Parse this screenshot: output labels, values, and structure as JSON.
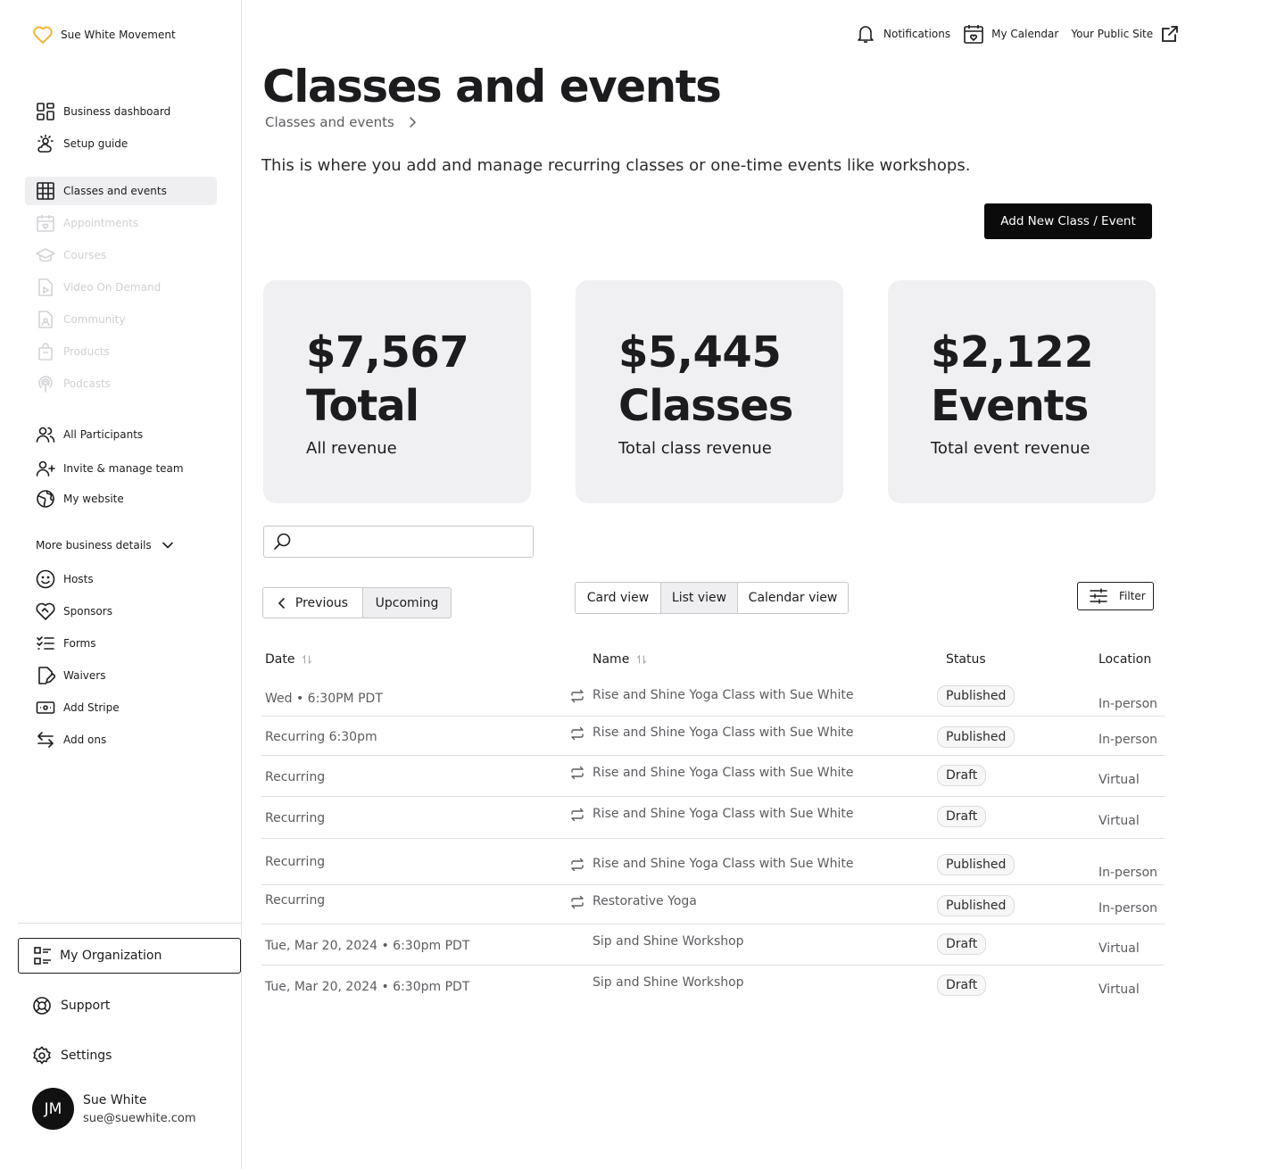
{
  "brand": {
    "name": "Sue White Movement",
    "icon": "heart-icon",
    "accent": "#f2b63c"
  },
  "topbar": {
    "notifications": "Notifications",
    "calendar": "My Calendar",
    "public_site": "Your Public Site"
  },
  "sidebar": {
    "main": [
      {
        "label": "Business dashboard",
        "icon": "dashboard-icon"
      },
      {
        "label": "Setup guide",
        "icon": "sun-cloud-icon"
      }
    ],
    "products": [
      {
        "label": "Classes and events",
        "icon": "table-icon",
        "active": true
      },
      {
        "label": "Appointments",
        "icon": "calendar-heart-icon",
        "disabled": true
      },
      {
        "label": "Courses",
        "icon": "graduation-cap-icon",
        "disabled": true
      },
      {
        "label": "Video On Demand",
        "icon": "video-file-icon",
        "disabled": true
      },
      {
        "label": "Community",
        "icon": "community-file-icon",
        "disabled": true
      },
      {
        "label": "Products",
        "icon": "bag-icon",
        "disabled": true
      },
      {
        "label": "Podcasts",
        "icon": "podcast-icon",
        "disabled": true
      }
    ],
    "people": [
      {
        "label": "All Participants",
        "icon": "users-icon"
      },
      {
        "label": "Invite & manage team",
        "icon": "user-plus-icon"
      },
      {
        "label": "My website",
        "icon": "globe-icon"
      }
    ],
    "more_label": "More business details",
    "details": [
      {
        "label": "Hosts",
        "icon": "smile-icon"
      },
      {
        "label": "Sponsors",
        "icon": "handshake-heart-icon"
      },
      {
        "label": "Forms",
        "icon": "checklist-icon"
      },
      {
        "label": "Waivers",
        "icon": "document-edit-icon"
      },
      {
        "label": "Add Stripe",
        "icon": "card-icon"
      },
      {
        "label": "Add ons",
        "icon": "arrows-swap-icon"
      }
    ],
    "organization": "My Organization",
    "support": "Support",
    "settings": "Settings",
    "user": {
      "initials": "JM",
      "name": "Sue White",
      "email": "sue@suewhite.com"
    }
  },
  "page": {
    "title": "Classes and events",
    "breadcrumb": "Classes and events",
    "intro": "This is where you add  and manage recurring classes or one-time events like workshops.",
    "add_button": "Add New Class / Event"
  },
  "stats": [
    {
      "amount": "$7,567",
      "label": "Total",
      "sub": "All revenue"
    },
    {
      "amount": "$5,445",
      "label": "Classes",
      "sub": "Total class revenue"
    },
    {
      "amount": "$2,122",
      "label": "Events",
      "sub": "Total event revenue"
    }
  ],
  "search": {
    "placeholder": ""
  },
  "time_toggle": {
    "previous": "Previous",
    "upcoming": "Upcoming",
    "selected": "Upcoming"
  },
  "view_toggle": {
    "card": "Card view",
    "list": "List view",
    "calendar": "Calendar view",
    "selected": "List view"
  },
  "filter_label": "Filter",
  "table": {
    "headers": {
      "date": "Date",
      "name": "Name",
      "status": "Status",
      "location": "Location"
    },
    "rows": [
      {
        "date": "Wed • 6:30PM PDT",
        "recurring": true,
        "name": "Rise and Shine Yoga Class with Sue White",
        "status": "Published",
        "location": "In-person"
      },
      {
        "date": "Recurring 6:30pm",
        "recurring": true,
        "name": "Rise and Shine Yoga Class with Sue White",
        "status": "Published",
        "location": "In-person"
      },
      {
        "date": "Recurring",
        "recurring": true,
        "name": "Rise and Shine Yoga Class with Sue White",
        "status": "Draft",
        "location": "Virtual"
      },
      {
        "date": "Recurring",
        "recurring": true,
        "name": "Rise and Shine Yoga Class with Sue White",
        "status": "Draft",
        "location": "Virtual"
      },
      {
        "date": "Recurring",
        "recurring": true,
        "name": "Rise and Shine Yoga Class with Sue White",
        "status": "Published",
        "location": "In-person"
      },
      {
        "date": "Recurring",
        "recurring": true,
        "name": "Restorative Yoga",
        "status": "Published",
        "location": "In-person"
      },
      {
        "date": "Tue, Mar 20, 2024 • 6:30pm PDT",
        "recurring": false,
        "name": "Sip and Shine Workshop",
        "status": "Draft",
        "location": "Virtual"
      },
      {
        "date": "Tue, Mar 20, 2024 • 6:30pm PDT",
        "recurring": false,
        "name": "Sip and Shine Workshop",
        "status": "Draft",
        "location": "Virtual"
      }
    ]
  }
}
